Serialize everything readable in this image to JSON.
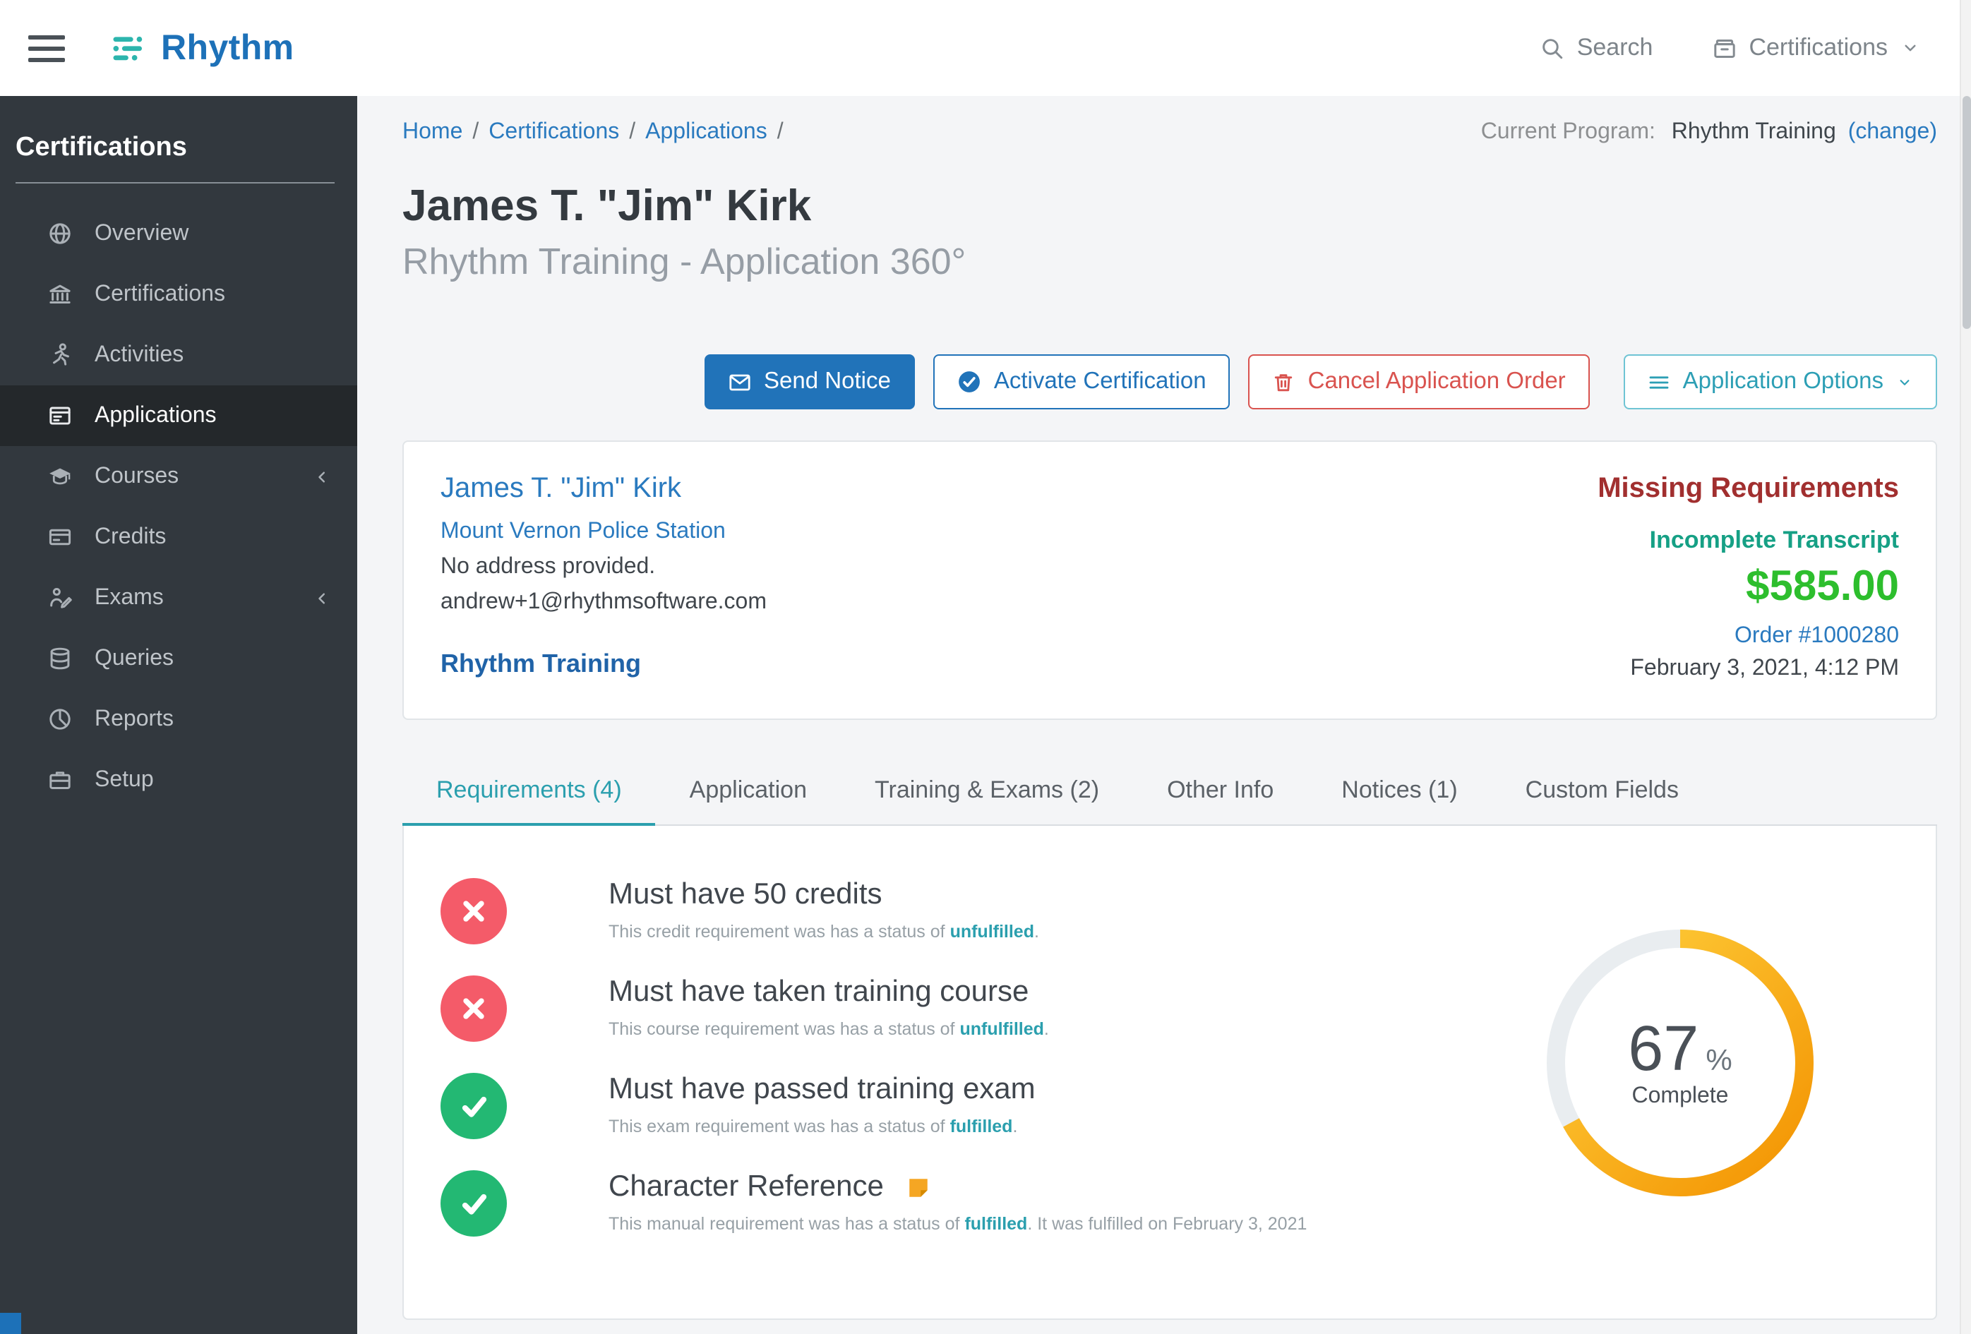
{
  "topbar": {
    "logo_text": "Rhythm",
    "search_label": "Search",
    "context_selector": "Certifications"
  },
  "sidebar": {
    "heading": "Certifications",
    "items": [
      {
        "label": "Overview",
        "icon": "globe-icon",
        "active": false,
        "expandable": false
      },
      {
        "label": "Certifications",
        "icon": "bank-icon",
        "active": false,
        "expandable": false
      },
      {
        "label": "Activities",
        "icon": "running-person-icon",
        "active": false,
        "expandable": false
      },
      {
        "label": "Applications",
        "icon": "application-card-icon",
        "active": true,
        "expandable": false
      },
      {
        "label": "Courses",
        "icon": "graduation-cap-icon",
        "active": false,
        "expandable": true
      },
      {
        "label": "Credits",
        "icon": "credit-card-icon",
        "active": false,
        "expandable": false
      },
      {
        "label": "Exams",
        "icon": "exam-writer-icon",
        "active": false,
        "expandable": true
      },
      {
        "label": "Queries",
        "icon": "database-icon",
        "active": false,
        "expandable": false
      },
      {
        "label": "Reports",
        "icon": "pie-chart-icon",
        "active": false,
        "expandable": false
      },
      {
        "label": "Setup",
        "icon": "briefcase-icon",
        "active": false,
        "expandable": false
      }
    ]
  },
  "breadcrumb": {
    "items": [
      "Home",
      "Certifications",
      "Applications"
    ]
  },
  "current_program": {
    "label": "Current Program:",
    "value": "Rhythm Training",
    "change_link": "(change)"
  },
  "page": {
    "title": "James T. \"Jim\" Kirk",
    "subtitle": "Rhythm Training - Application 360°"
  },
  "actions": {
    "send_notice": "Send Notice",
    "activate_certification": "Activate Certification",
    "cancel_application_order": "Cancel Application Order",
    "application_options": "Application Options"
  },
  "summary": {
    "name": "James T. \"Jim\" Kirk",
    "organization": "Mount Vernon Police Station",
    "address": "No address provided.",
    "email": "andrew+1@rhythmsoftware.com",
    "program": "Rhythm Training",
    "missing_requirements": "Missing Requirements",
    "transcript_status": "Incomplete Transcript",
    "amount": "$585.00",
    "order": "Order #1000280",
    "order_date": "February 3, 2021, 4:12 PM"
  },
  "tabs": [
    {
      "label": "Requirements (4)",
      "active": true
    },
    {
      "label": "Application",
      "active": false
    },
    {
      "label": "Training & Exams (2)",
      "active": false
    },
    {
      "label": "Other Info",
      "active": false
    },
    {
      "label": "Notices (1)",
      "active": false
    },
    {
      "label": "Custom Fields",
      "active": false
    }
  ],
  "requirements": {
    "rows": [
      {
        "status": "unfulfilled",
        "title": "Must have 50 credits",
        "desc_prefix": "This credit requirement was has a status of ",
        "status_word": "unfulfilled",
        "desc_suffix": ".",
        "note": false
      },
      {
        "status": "unfulfilled",
        "title": "Must have taken training course",
        "desc_prefix": "This course requirement was has a status of ",
        "status_word": "unfulfilled",
        "desc_suffix": ".",
        "note": false
      },
      {
        "status": "fulfilled",
        "title": "Must have passed training exam",
        "desc_prefix": "This exam requirement was has a status of ",
        "status_word": "fulfilled",
        "desc_suffix": ".",
        "note": false
      },
      {
        "status": "fulfilled",
        "title": "Character Reference",
        "desc_prefix": "This manual requirement was has a status of ",
        "status_word": "fulfilled",
        "desc_suffix": ". It was fulfilled on February 3, 2021",
        "note": true
      }
    ]
  },
  "progress": {
    "percent": 67,
    "unit": "%",
    "label": "Complete"
  },
  "colors": {
    "brand_blue": "#1d71b8",
    "accent_teal": "#2b9fae",
    "logo_teal": "#2cb5ad",
    "danger_red": "#d9534f",
    "missing_red": "#a12f2f",
    "transcript_teal": "#16a085",
    "amount_green": "#2dbe2d",
    "fulfilled_circle": "#23b873",
    "unfulfilled_circle": "#f45b69",
    "donut_orange": "#f39200",
    "donut_yellow": "#ffd23f",
    "sidebar_bg": "#32383e"
  }
}
